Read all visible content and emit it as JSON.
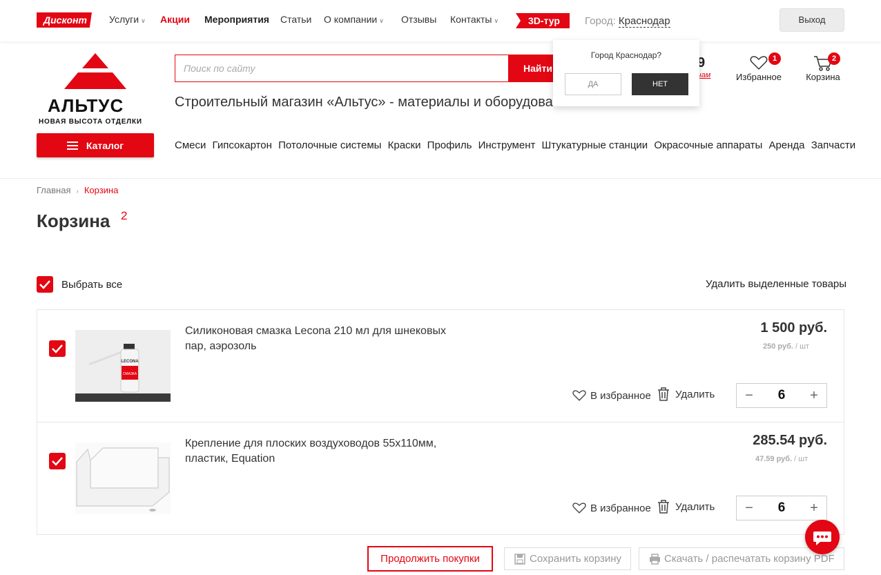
{
  "topbar": {
    "discount_tag": "Дисконт",
    "nav": [
      {
        "label": "Услуги",
        "has_dropdown": true
      },
      {
        "label": "Акции",
        "highlight": true
      },
      {
        "label": "Мероприятия",
        "bold": true
      },
      {
        "label": "Статьи"
      },
      {
        "label": "О компании",
        "has_dropdown": true
      },
      {
        "label": "Отзывы"
      },
      {
        "label": "Контакты",
        "has_dropdown": true
      }
    ],
    "tour_tag": "3D-тур",
    "city_label": "Город:",
    "city_value": "Краснодар",
    "exit_label": "Выход"
  },
  "logo": {
    "name": "АЛЬТУС",
    "tagline": "НОВАЯ ВЫСОТА ОТДЕЛКИ"
  },
  "catalog_label": "Каталог",
  "search": {
    "placeholder": "Поиск по сайту",
    "button": "Найти"
  },
  "store_title": "Строительный магазин «Альтус» - материалы и оборудование",
  "phone": {
    "fragment": "9",
    "link_fragment": "чам"
  },
  "header_icons": {
    "favorites": {
      "label": "Избранное",
      "count": "1"
    },
    "cart": {
      "label": "Корзина",
      "count": "2"
    }
  },
  "city_popup": {
    "question": "Город Краснодар?",
    "yes": "ДА",
    "no": "НЕТ"
  },
  "category_nav": [
    "Смеси",
    "Гипсокартон",
    "Потолочные системы",
    "Краски",
    "Профиль",
    "Инструмент",
    "Штукатурные станции",
    "Окрасочные аппараты",
    "Аренда",
    "Запчасти"
  ],
  "breadcrumbs": {
    "home": "Главная",
    "current": "Корзина"
  },
  "page": {
    "title": "Корзина",
    "count": "2"
  },
  "cart": {
    "select_all": "Выбрать все",
    "delete_selected": "Удалить выделенные товары",
    "items": [
      {
        "name": "Силиконовая смазка Lecona 210 мл для шнековых пар, аэрозоль",
        "price": "1 500 руб.",
        "unit_price": "250 руб.",
        "unit": "/ шт",
        "favorite_label": "В избранное",
        "delete_label": "Удалить",
        "qty": "6",
        "checked": true,
        "image_label_brand": "LECONA",
        "image_label_text": "СМАЗКА"
      },
      {
        "name": "Крепление для плоских воздуховодов 55х110мм, пластик, Equation",
        "price": "285.54 руб.",
        "unit_price": "47.59 руб.",
        "unit": "/ шт",
        "favorite_label": "В избранное",
        "delete_label": "Удалить",
        "qty": "6",
        "checked": true
      }
    ],
    "qty_minus": "−",
    "qty_plus": "+"
  },
  "actions": {
    "continue": "Продолжить покупки",
    "save": "Сохранить корзину",
    "download": "Скачать / распечатать корзину PDF"
  },
  "colors": {
    "accent": "#e30613",
    "text": "#333333",
    "muted": "#aaaaaa"
  }
}
